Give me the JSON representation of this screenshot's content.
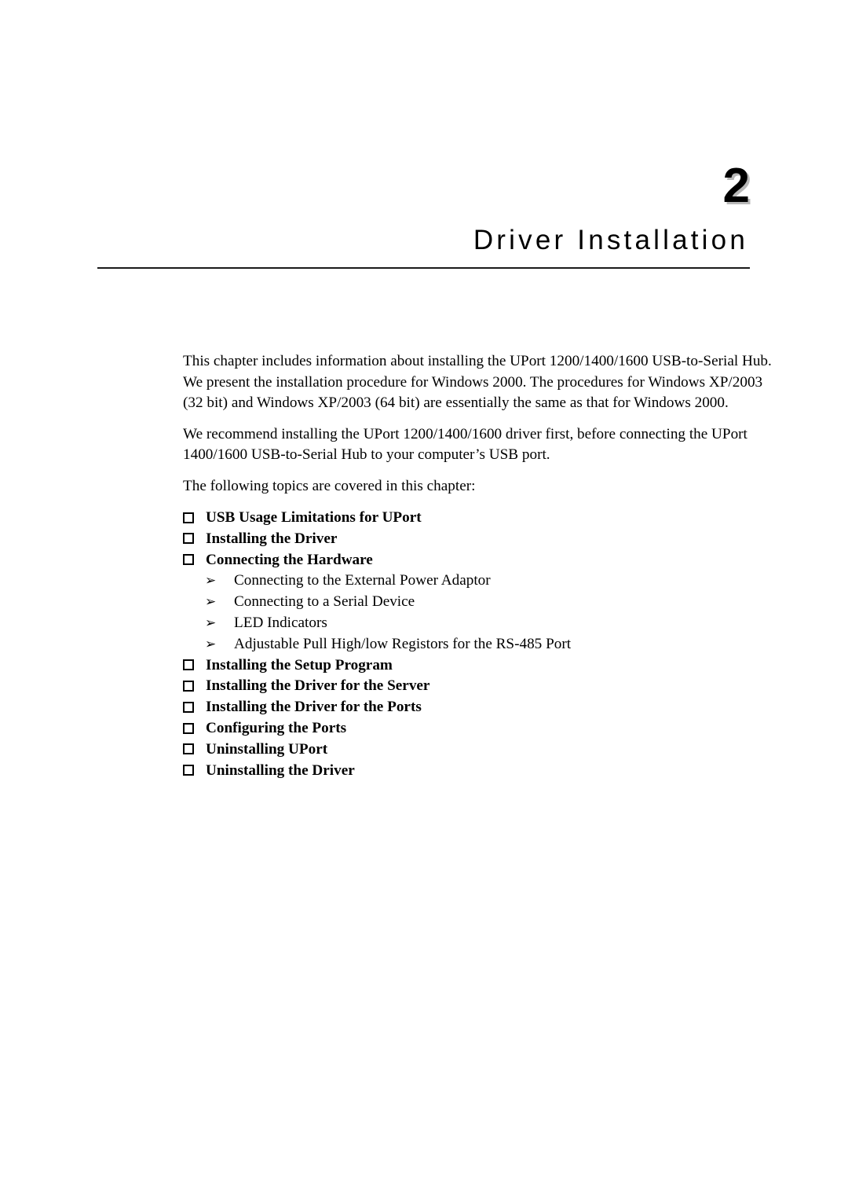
{
  "chapter": {
    "number": "2",
    "title": "Driver Installation"
  },
  "intro": {
    "paragraph1_line1": "This chapter includes information about installing the UPort 1200/1400/1600 USB-to-Serial Hub.",
    "paragraph1_line2": "We present the installation procedure for Windows 2000. The procedures for Windows XP/2003",
    "paragraph1_line3": "(32 bit) and Windows XP/2003 (64 bit) are essentially the same as that for Windows 2000.",
    "paragraph2_line1": "We recommend installing the UPort 1200/1400/1600 driver first, before connecting the UPort",
    "paragraph2_line2": "1400/1600 USB-to-Serial Hub to your computer’s USB port.",
    "paragraph3": "The following topics are covered in this chapter:"
  },
  "topics": [
    {
      "label": "USB Usage Limitations for UPort",
      "bullet": "checkbox-bullet-icon"
    },
    {
      "label": "Installing the Driver",
      "bullet": "checkbox-bullet-icon"
    },
    {
      "label": "Connecting the Hardware",
      "bullet": "checkbox-bullet-icon"
    },
    {
      "label": "Installing the Setup Program",
      "bullet": "checkbox-bullet-icon"
    },
    {
      "label": "Installing the Driver for the Server",
      "bullet": "checkbox-bullet-icon"
    },
    {
      "label": "Installing the Driver for the Ports",
      "bullet": "checkbox-bullet-icon"
    },
    {
      "label": "Configuring the Ports",
      "bullet": "checkbox-bullet-icon"
    },
    {
      "label": "Uninstalling UPort",
      "bullet": "checkbox-bullet-icon"
    },
    {
      "label": "Uninstalling the Driver",
      "bullet": "checkbox-bullet-icon"
    }
  ],
  "subtopics": [
    {
      "label": "Connecting to the External Power Adaptor",
      "bullet": "➢"
    },
    {
      "label": "Connecting to a Serial Device",
      "bullet": "➢"
    },
    {
      "label": "LED Indicators",
      "bullet": "➢"
    },
    {
      "label": "Adjustable Pull High/low Registors for the RS-485 Port",
      "bullet": "➢"
    }
  ],
  "colors": {
    "text": "#000000",
    "rule": "#1a1a1a",
    "number_shadow": "#b8b8b8",
    "bullet_shadow": "#9a9a9a",
    "background": "#ffffff"
  }
}
